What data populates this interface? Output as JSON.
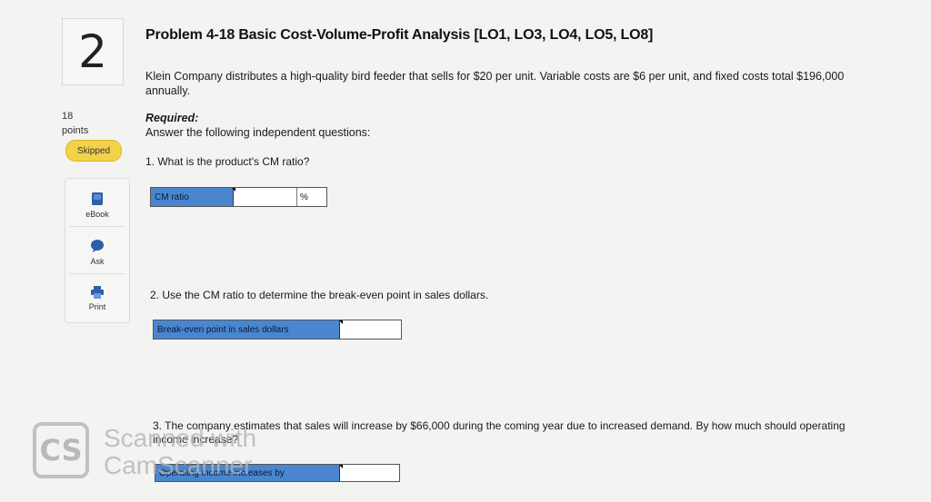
{
  "question": {
    "number": "2",
    "points_value": "18",
    "points_label": "points",
    "status": "Skipped"
  },
  "tools": [
    {
      "label": "eBook",
      "icon": "book-icon"
    },
    {
      "label": "Ask",
      "icon": "chat-bubble-icon"
    },
    {
      "label": "Print",
      "icon": "printer-icon"
    }
  ],
  "problem": {
    "title": "Problem 4-18 Basic Cost-Volume-Profit Analysis [LO1, LO3, LO4, LO5, LO8]",
    "intro": "Klein Company distributes a high-quality bird feeder that sells for $20 per unit. Variable costs are $6 per unit, and fixed costs total $196,000 annually.",
    "required_label": "Required:",
    "required_text": "Answer the following independent questions:"
  },
  "parts": [
    {
      "question": "1. What is the product's CM ratio?",
      "field_label": "CM ratio",
      "value": "",
      "unit": "%"
    },
    {
      "question": "2. Use the CM ratio to determine the break-even point in sales dollars.",
      "field_label": "Break-even point in sales dollars",
      "value": ""
    },
    {
      "question": "3. The company estimates that sales will increase by $66,000 during the coming year due to increased demand. By how much should operating income increase?",
      "field_label": "Operating income increases by",
      "value": ""
    }
  ],
  "watermark": {
    "logo": "CS",
    "line1": "Scanned with",
    "line2": "CamScanner"
  },
  "colors": {
    "field_label_bg": "#4a86d0",
    "skipped_badge": "#f3d24a"
  }
}
